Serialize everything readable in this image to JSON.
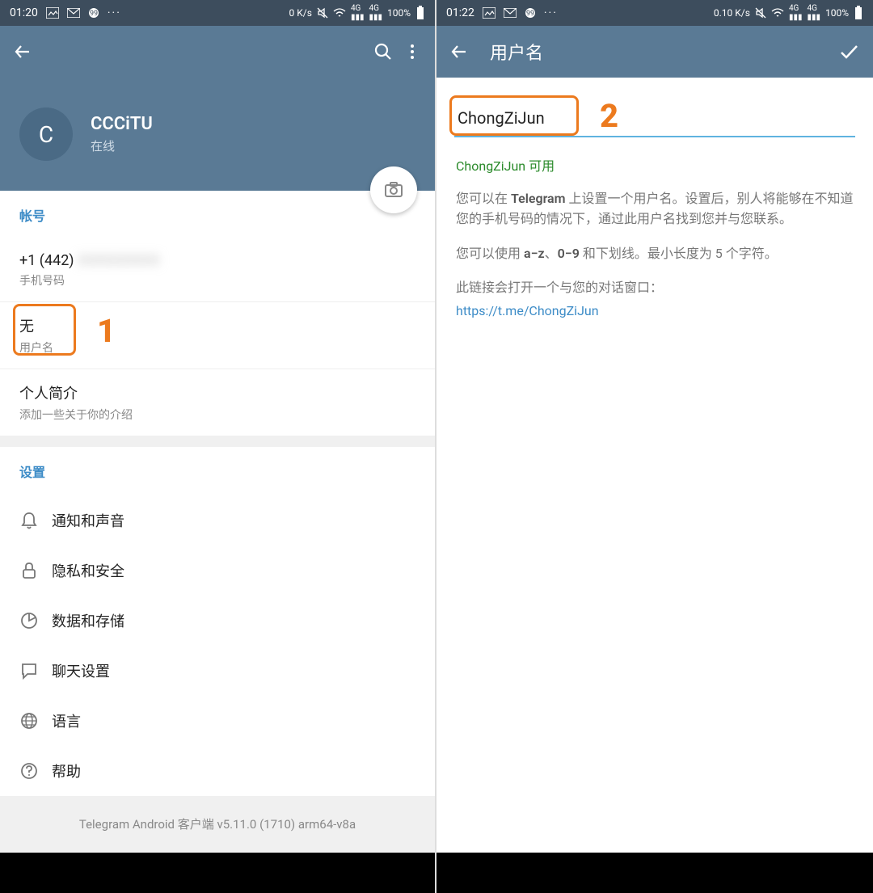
{
  "left": {
    "status": {
      "time": "01:20",
      "speed": "0 K/s",
      "battery": "100%",
      "dots": "···"
    },
    "profile": {
      "name": "CCCiTU",
      "status": "在线",
      "avatar_letter": "C"
    },
    "account": {
      "header": "帐号",
      "phone_value": "+1 (442)",
      "phone_label": "手机号码",
      "username_value": "无",
      "username_label": "用户名",
      "bio_value": "个人简介",
      "bio_label": "添加一些关于你的介绍"
    },
    "settings_header": "设置",
    "settings": {
      "notifications": "通知和声音",
      "privacy": "隐私和安全",
      "data": "数据和存储",
      "chat": "聊天设置",
      "language": "语言",
      "help": "帮助"
    },
    "version": "Telegram Android 客户端 v5.11.0 (1710) arm64-v8a",
    "annotation": "1"
  },
  "right": {
    "status": {
      "time": "01:22",
      "speed": "0.10 K/s",
      "battery": "100%",
      "dots": "···"
    },
    "header_title": "用户名",
    "input_value": "ChongZiJun",
    "available_text": "ChongZiJun 可用",
    "desc1_pre": "您可以在 ",
    "desc1_bold": "Telegram",
    "desc1_post": " 上设置一个用户名。设置后，别人将能够在不知道您的手机号码的情况下，通过此用户名找到您并与您联系。",
    "desc2_pre": "您可以使用 ",
    "desc2_b1": "a−z",
    "desc2_sep1": "、",
    "desc2_b2": "0−9",
    "desc2_post": " 和下划线。最小长度为 5 个字符。",
    "desc3": "此链接会打开一个与您的对话窗口：",
    "link": "https://t.me/ChongZiJun",
    "annotation": "2"
  }
}
